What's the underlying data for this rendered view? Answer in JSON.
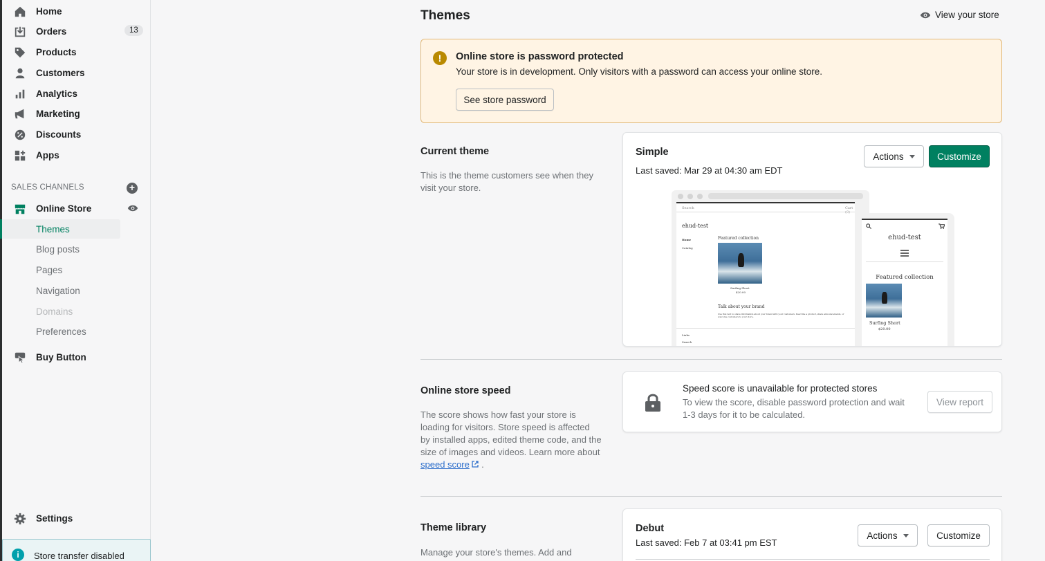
{
  "sidebar": {
    "items": [
      {
        "label": "Home",
        "icon": "home-icon"
      },
      {
        "label": "Orders",
        "icon": "orders-icon",
        "badge": "13"
      },
      {
        "label": "Products",
        "icon": "tag-icon"
      },
      {
        "label": "Customers",
        "icon": "person-icon"
      },
      {
        "label": "Analytics",
        "icon": "bar-chart-icon"
      },
      {
        "label": "Marketing",
        "icon": "megaphone-icon"
      },
      {
        "label": "Discounts",
        "icon": "discount-icon"
      },
      {
        "label": "Apps",
        "icon": "apps-icon"
      }
    ],
    "sales_channels_title": "SALES CHANNELS",
    "online_store": {
      "label": "Online Store"
    },
    "sub_items": [
      {
        "label": "Themes",
        "state": "active"
      },
      {
        "label": "Blog posts"
      },
      {
        "label": "Pages"
      },
      {
        "label": "Navigation"
      },
      {
        "label": "Domains",
        "state": "disabled"
      },
      {
        "label": "Preferences"
      }
    ],
    "buy_button": {
      "label": "Buy Button"
    },
    "settings": {
      "label": "Settings"
    },
    "transfer": {
      "label": "Store transfer disabled"
    }
  },
  "header": {
    "title": "Themes",
    "view_store": "View your store"
  },
  "banner": {
    "title": "Online store is password protected",
    "message": "Your store is in development. Only visitors with a password can access your online store.",
    "button": "See store password",
    "color": "#fff4e4"
  },
  "current_theme": {
    "heading": "Current theme",
    "description": "This is the theme customers see when they visit your store.",
    "name": "Simple",
    "saved": "Last saved: Mar 29 at 04:30 am EDT",
    "actions": "Actions",
    "customize": "Customize",
    "preview": {
      "store_name": "ehud-test",
      "search": "Search",
      "cart": "Cart (0)",
      "nav_home": "Home",
      "nav_catalog": "Catalog",
      "featured": "Featured collection",
      "product": "Surfing Short",
      "price": "$20.00",
      "brand": "Talk about your brand",
      "brand_text": "Use this text to share information about your brand with your customers. Describe a product, share announcements, or welcome customers to your store.",
      "links": "Links",
      "link_search": "Search"
    }
  },
  "speed": {
    "heading": "Online store speed",
    "description": "The score shows how fast your store is loading for visitors. Store speed is affected by installed apps, edited theme code, and the size of images and videos. Learn more about",
    "link": "speed score",
    "period": ".",
    "card_title": "Speed score is unavailable for protected stores",
    "card_message": "To view the score, disable password protection and wait 1-3 days for it to be calculated.",
    "button": "View report"
  },
  "library": {
    "heading": "Theme library",
    "description": "Manage your store's themes. Add and publish",
    "name": "Debut",
    "saved": "Last saved: Feb 7 at 03:41 pm EST",
    "actions": "Actions",
    "customize": "Customize"
  },
  "colors": {
    "accent": "#008060",
    "link": "#2c6ecb"
  }
}
